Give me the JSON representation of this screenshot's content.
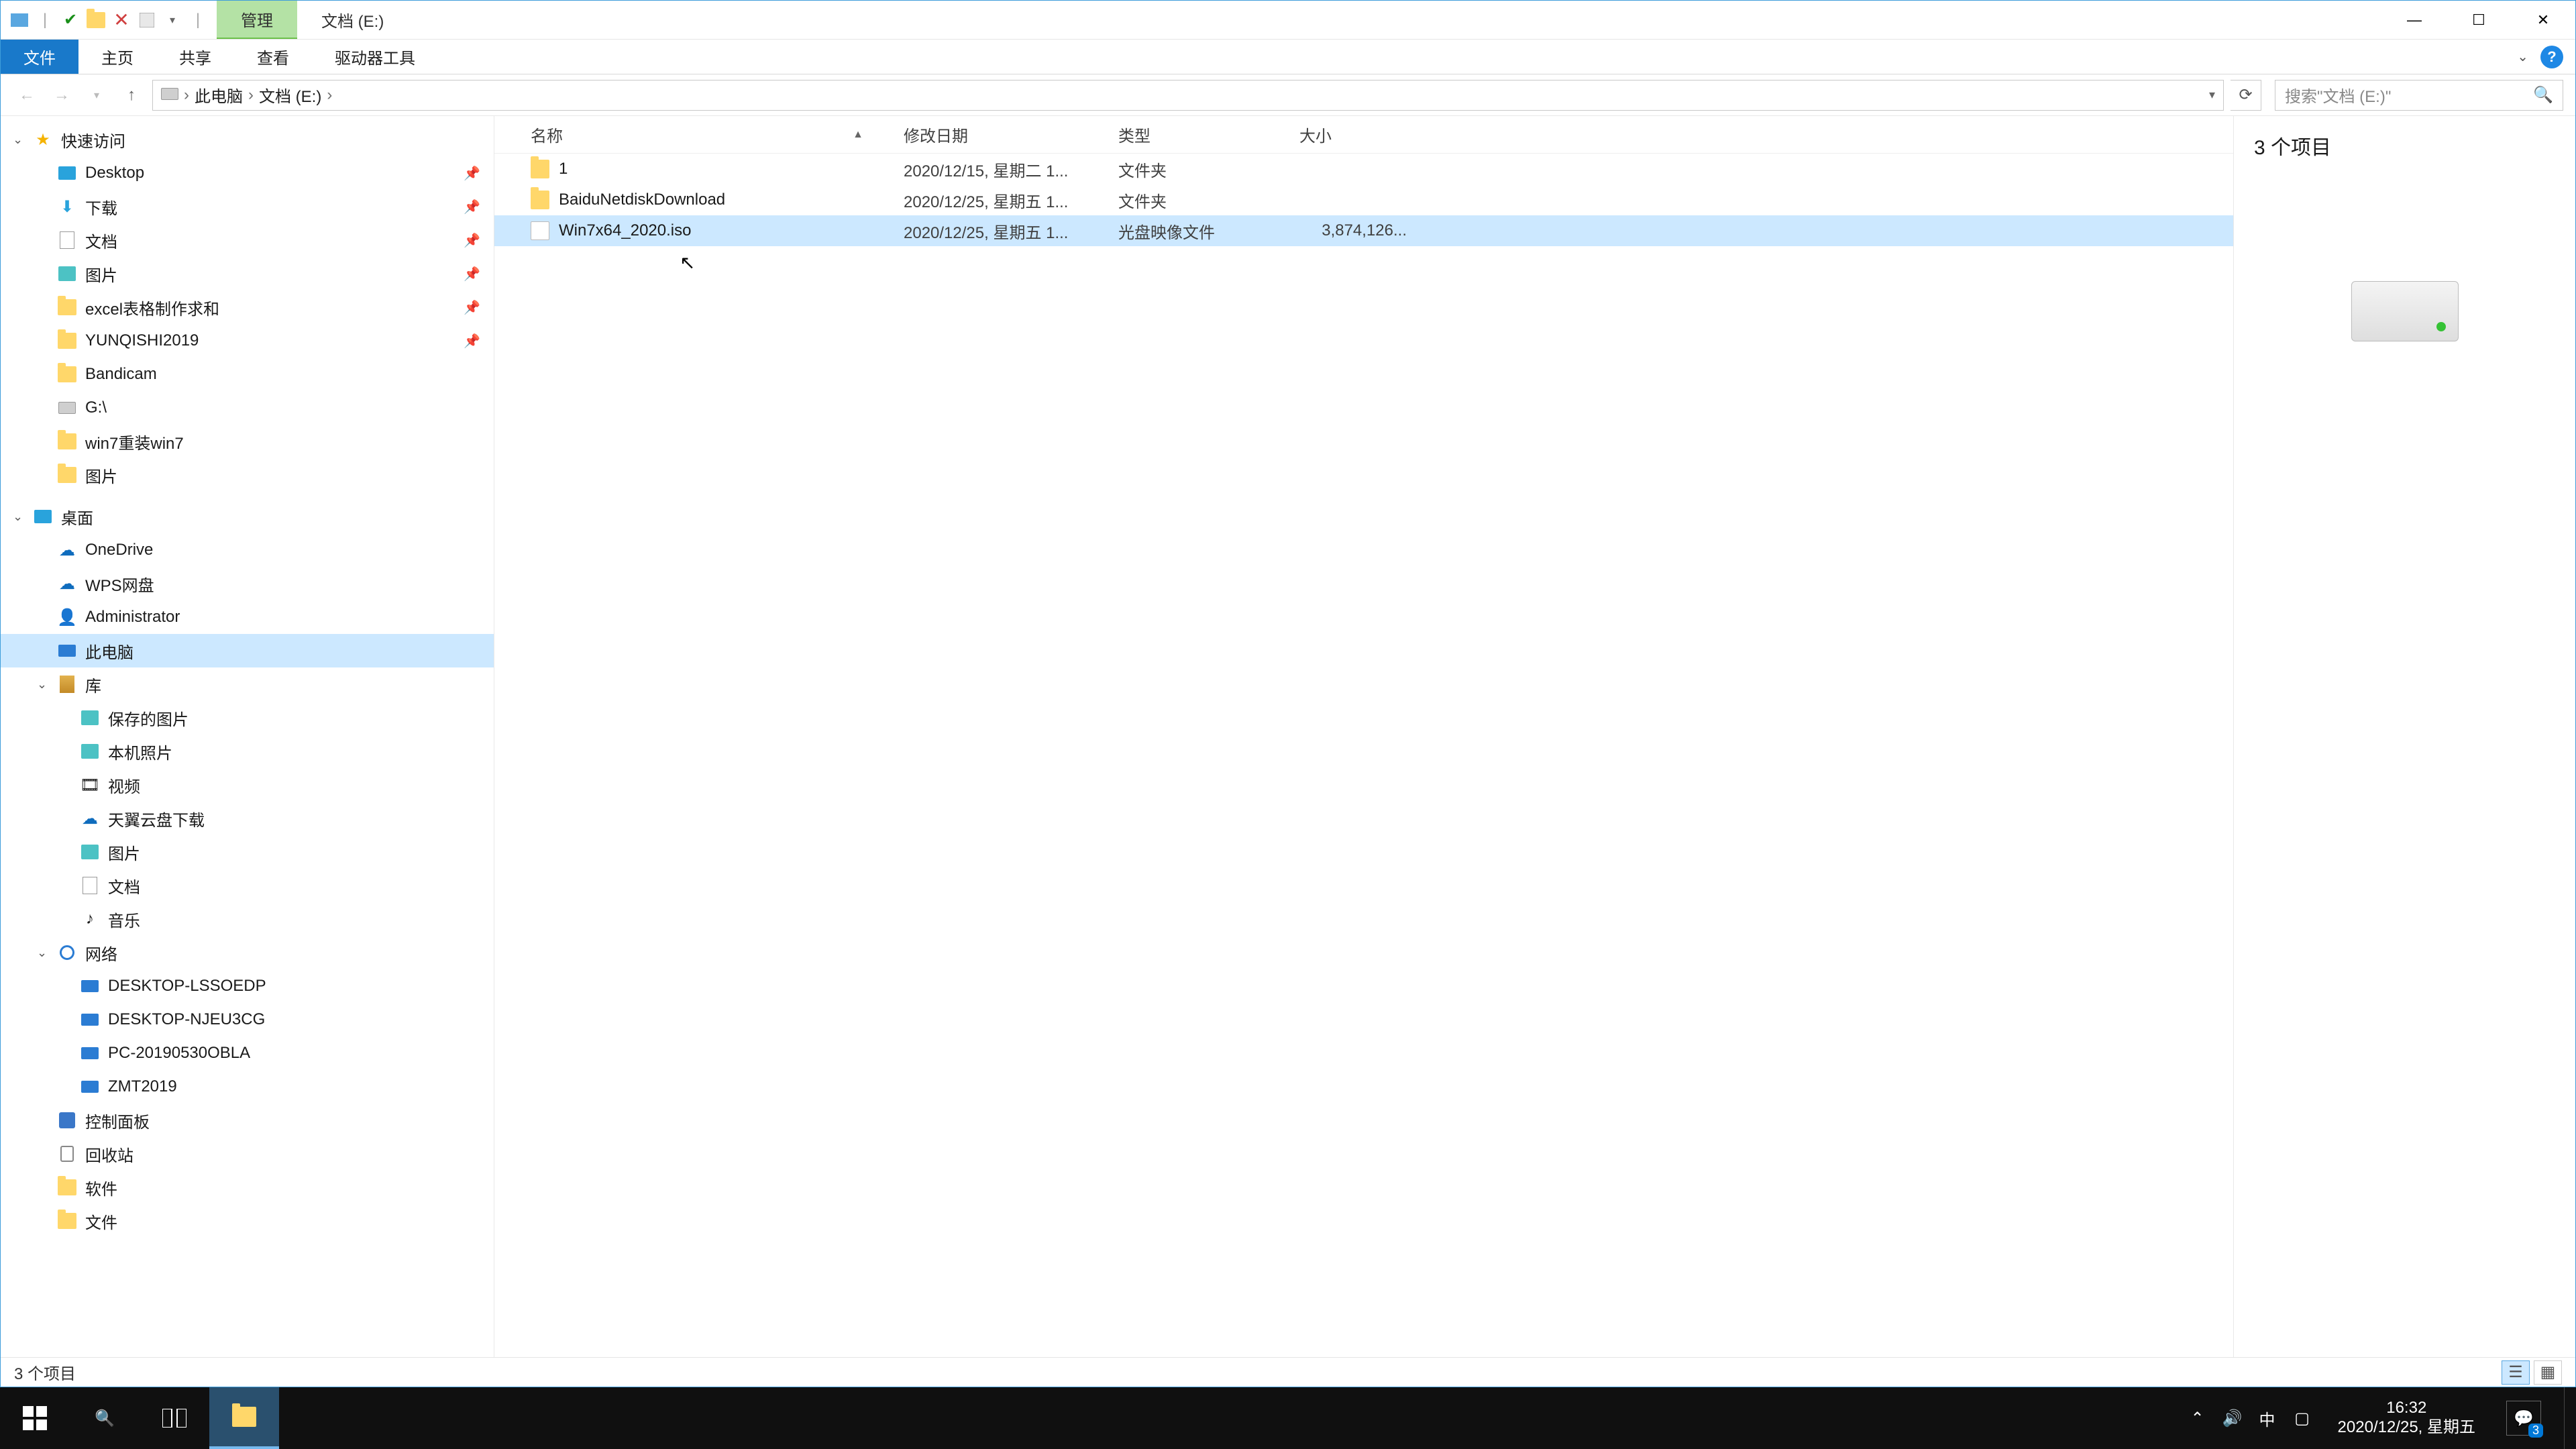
{
  "title": {
    "manage": "管理",
    "location": "文档 (E:)"
  },
  "ribbon": {
    "file": "文件",
    "home": "主页",
    "share": "共享",
    "view": "查看",
    "drivetools": "驱动器工具"
  },
  "breadcrumb": {
    "seg0": "此电脑",
    "seg1": "文档 (E:)"
  },
  "search": {
    "placeholder": "搜索\"文档 (E:)\""
  },
  "columns": {
    "name": "名称",
    "date": "修改日期",
    "type": "类型",
    "size": "大小"
  },
  "files": [
    {
      "name": "1",
      "date": "2020/12/15, 星期二 1...",
      "type": "文件夹",
      "size": "",
      "icon": "folder"
    },
    {
      "name": "BaiduNetdiskDownload",
      "date": "2020/12/25, 星期五 1...",
      "type": "文件夹",
      "size": "",
      "icon": "folder"
    },
    {
      "name": "Win7x64_2020.iso",
      "date": "2020/12/25, 星期五 1...",
      "type": "光盘映像文件",
      "size": "3,874,126...",
      "icon": "iso"
    }
  ],
  "preview": {
    "header": "3 个项目"
  },
  "status": {
    "text": "3 个项目"
  },
  "tree": {
    "quick": "快速访问",
    "quick_items": [
      "Desktop",
      "下载",
      "文档",
      "图片",
      "excel表格制作求和",
      "YUNQISHI2019",
      "Bandicam",
      "G:\\",
      "win7重装win7",
      "图片"
    ],
    "deskroot": "桌面",
    "onedrive": "OneDrive",
    "wps": "WPS网盘",
    "admin": "Administrator",
    "thispc": "此电脑",
    "lib": "库",
    "lib_items": [
      "保存的图片",
      "本机照片",
      "视频",
      "天翼云盘下载",
      "图片",
      "文档",
      "音乐"
    ],
    "network": "网络",
    "net_items": [
      "DESKTOP-LSSOEDP",
      "DESKTOP-NJEU3CG",
      "PC-20190530OBLA",
      "ZMT2019"
    ],
    "cp": "控制面板",
    "recycle": "回收站",
    "soft": "软件",
    "docs": "文件"
  },
  "taskbar": {
    "time": "16:32",
    "date": "2020/12/25, 星期五",
    "ime": "中",
    "ac_badge": "3"
  }
}
